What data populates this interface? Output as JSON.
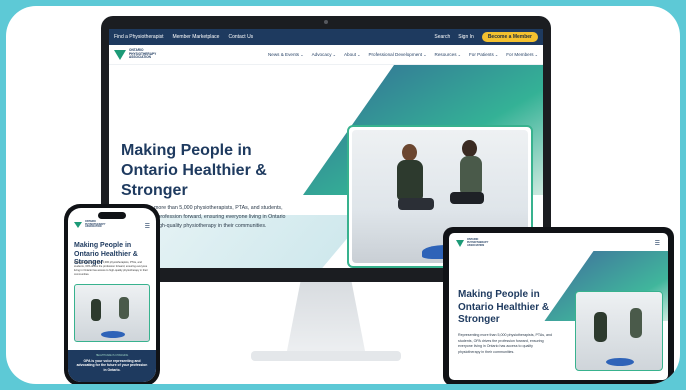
{
  "desktop": {
    "topbar": {
      "links": [
        "Find a Physiotherapist",
        "Member Marketplace",
        "Contact Us"
      ],
      "search": "Search",
      "sign_in": "Sign In",
      "cta": "Become a Member"
    },
    "logo_text": "ONTARIO PHYSIOTHERAPY ASSOCIATION",
    "nav": [
      "News & Events",
      "Advocacy",
      "About",
      "Professional Development",
      "Resources",
      "For Patients",
      "For Members"
    ],
    "hero": {
      "title": "Making People in Ontario Healthier & Stronger",
      "body": "Representing more than 5,000 physiotherapists, PTAs, and students, OPA drives the profession forward, ensuring everyone living in Ontario has access to high-quality physiotherapy in their communities."
    }
  },
  "phone": {
    "title": "Making People in Ontario Healthier & Stronger",
    "body": "Representing more than 5,000 physiotherapists, PTAs, and students, OPA drives the profession forward, ensuring everyone living in Ontario has access to high-quality physiotherapy in their communities.",
    "band_small": "HEALTHCARE IS CHANGING",
    "band_text": "OPA is your voice representing and advocating for the future of your profession in Ontario."
  },
  "tablet": {
    "title": "Making People in Ontario Healthier & Stronger",
    "body": "Representing more than 5,000 physiotherapists, PTAs, and students, OPA drives the profession forward, ensuring everyone living in Ontario has access to quality physiotherapy in their communities."
  },
  "colors": {
    "background": "#5dc9d6",
    "navy": "#1e3a5f",
    "green": "#1c9a77",
    "cta": "#f4c12f"
  }
}
